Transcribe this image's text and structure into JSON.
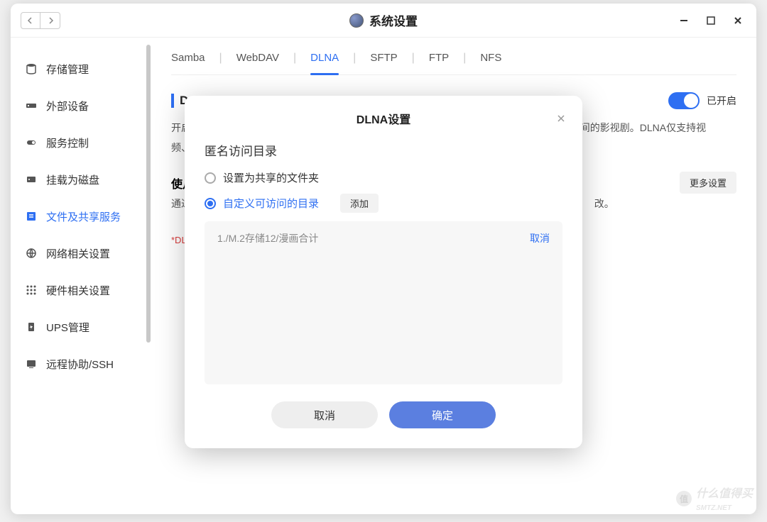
{
  "window": {
    "title": "系统设置"
  },
  "sidebar": {
    "items": [
      {
        "label": "存储管理",
        "icon": "storage"
      },
      {
        "label": "外部设备",
        "icon": "external"
      },
      {
        "label": "服务控制",
        "icon": "service"
      },
      {
        "label": "挂载为磁盘",
        "icon": "mount"
      },
      {
        "label": "文件及共享服务",
        "icon": "share"
      },
      {
        "label": "网络相关设置",
        "icon": "network"
      },
      {
        "label": "硬件相关设置",
        "icon": "hardware"
      },
      {
        "label": "UPS管理",
        "icon": "ups"
      },
      {
        "label": "远程协助/SSH",
        "icon": "ssh"
      }
    ]
  },
  "tabs": [
    "Samba",
    "WebDAV",
    "DLNA",
    "SFTP",
    "FTP",
    "NFS"
  ],
  "active_tab": "DLNA",
  "section": {
    "title_prefix": "D",
    "desc_prefix": "开启",
    "desc_suffix": "间的影视剧。DLNA仅支持视",
    "desc_line2": "频、",
    "sub_title": "使月",
    "sub_desc": "通过",
    "sub_desc_suffix": "改。",
    "toggle_label": "已开启",
    "more": "更多设置",
    "footnote": "*DL"
  },
  "modal": {
    "title": "DLNA设置",
    "section_title": "匿名访问目录",
    "radio1": "设置为共享的文件夹",
    "radio2": "自定义可访问的目录",
    "add": "添加",
    "dir_item": {
      "path": "1./M.2存储12/漫画合计",
      "cancel": "取消"
    },
    "cancel": "取消",
    "ok": "确定"
  },
  "watermark": {
    "badge": "值",
    "text": "什么值得买",
    "sub": "SMTZ.NET"
  }
}
